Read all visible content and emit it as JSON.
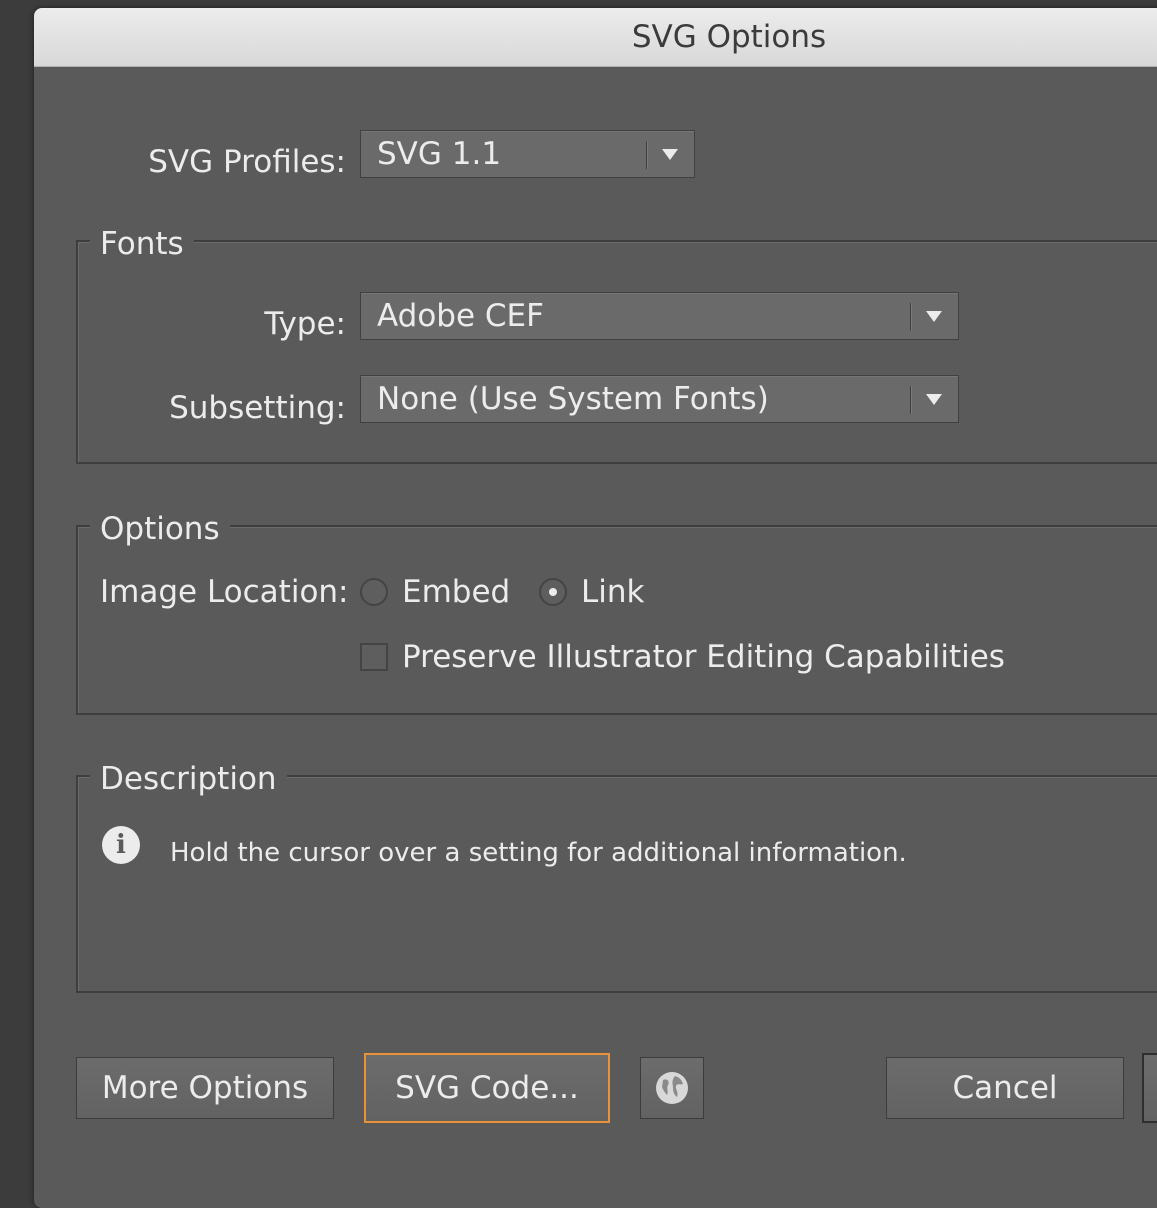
{
  "window": {
    "title": "SVG Options"
  },
  "svg_profiles": {
    "label": "SVG Profiles:",
    "value": "SVG 1.1"
  },
  "fonts": {
    "legend": "Fonts",
    "type_label": "Type:",
    "type_value": "Adobe CEF",
    "subsetting_label": "Subsetting:",
    "subsetting_value": "None (Use System Fonts)"
  },
  "options": {
    "legend": "Options",
    "image_location_label": "Image Location:",
    "embed_label": "Embed",
    "link_label": "Link",
    "selected": "Link",
    "preserve_label": "Preserve Illustrator Editing Capabilities",
    "preserve_checked": false
  },
  "description": {
    "legend": "Description",
    "text": "Hold the cursor over a setting for additional information.",
    "icon": "info-icon"
  },
  "buttons": {
    "more_options": "More Options",
    "svg_code": "SVG Code...",
    "web_icon": "globe-icon",
    "cancel": "Cancel"
  },
  "colors": {
    "dialog_bg": "#5a5a5a",
    "focus_ring": "#e8923a",
    "text": "#ececec"
  }
}
